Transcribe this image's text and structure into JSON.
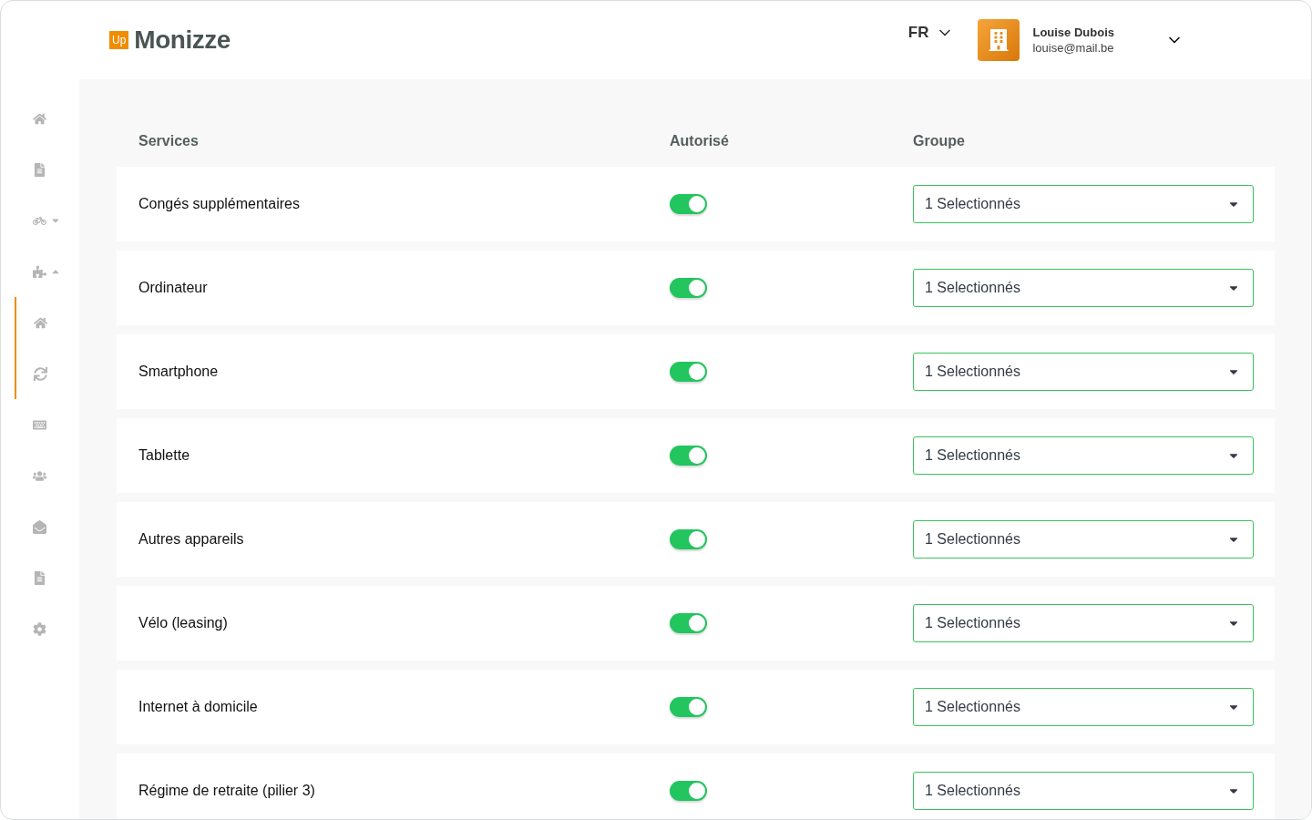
{
  "header": {
    "logo_badge": "Up",
    "logo_text": "Monizze",
    "language": "FR",
    "user": {
      "name": "Louise Dubois",
      "email": "louise@mail.be"
    }
  },
  "sidebar": {
    "items": [
      {
        "kind": "link"
      },
      {
        "kind": "link"
      },
      {
        "kind": "group",
        "expanded": false
      },
      {
        "kind": "group",
        "expanded": true,
        "children": [
          {
            "kind": "link"
          },
          {
            "kind": "link"
          }
        ]
      },
      {
        "kind": "link"
      },
      {
        "kind": "link"
      },
      {
        "kind": "link"
      },
      {
        "kind": "link"
      },
      {
        "kind": "link"
      }
    ]
  },
  "table": {
    "columns": [
      "Services",
      "Autorisé",
      "Groupe"
    ],
    "rows": [
      {
        "service": "Congés supplémentaires",
        "authorized": true,
        "group": "1 Selectionnés"
      },
      {
        "service": "Ordinateur",
        "authorized": true,
        "group": "1 Selectionnés"
      },
      {
        "service": "Smartphone",
        "authorized": true,
        "group": "1 Selectionnés"
      },
      {
        "service": "Tablette",
        "authorized": true,
        "group": "1 Selectionnés"
      },
      {
        "service": "Autres appareils",
        "authorized": true,
        "group": "1 Selectionnés"
      },
      {
        "service": "Vélo (leasing)",
        "authorized": true,
        "group": "1 Selectionnés"
      },
      {
        "service": "Internet à domicile",
        "authorized": true,
        "group": "1 Selectionnés"
      },
      {
        "service": "Régime de retraite (pilier 3)",
        "authorized": true,
        "group": "1 Selectionnés"
      }
    ]
  }
}
